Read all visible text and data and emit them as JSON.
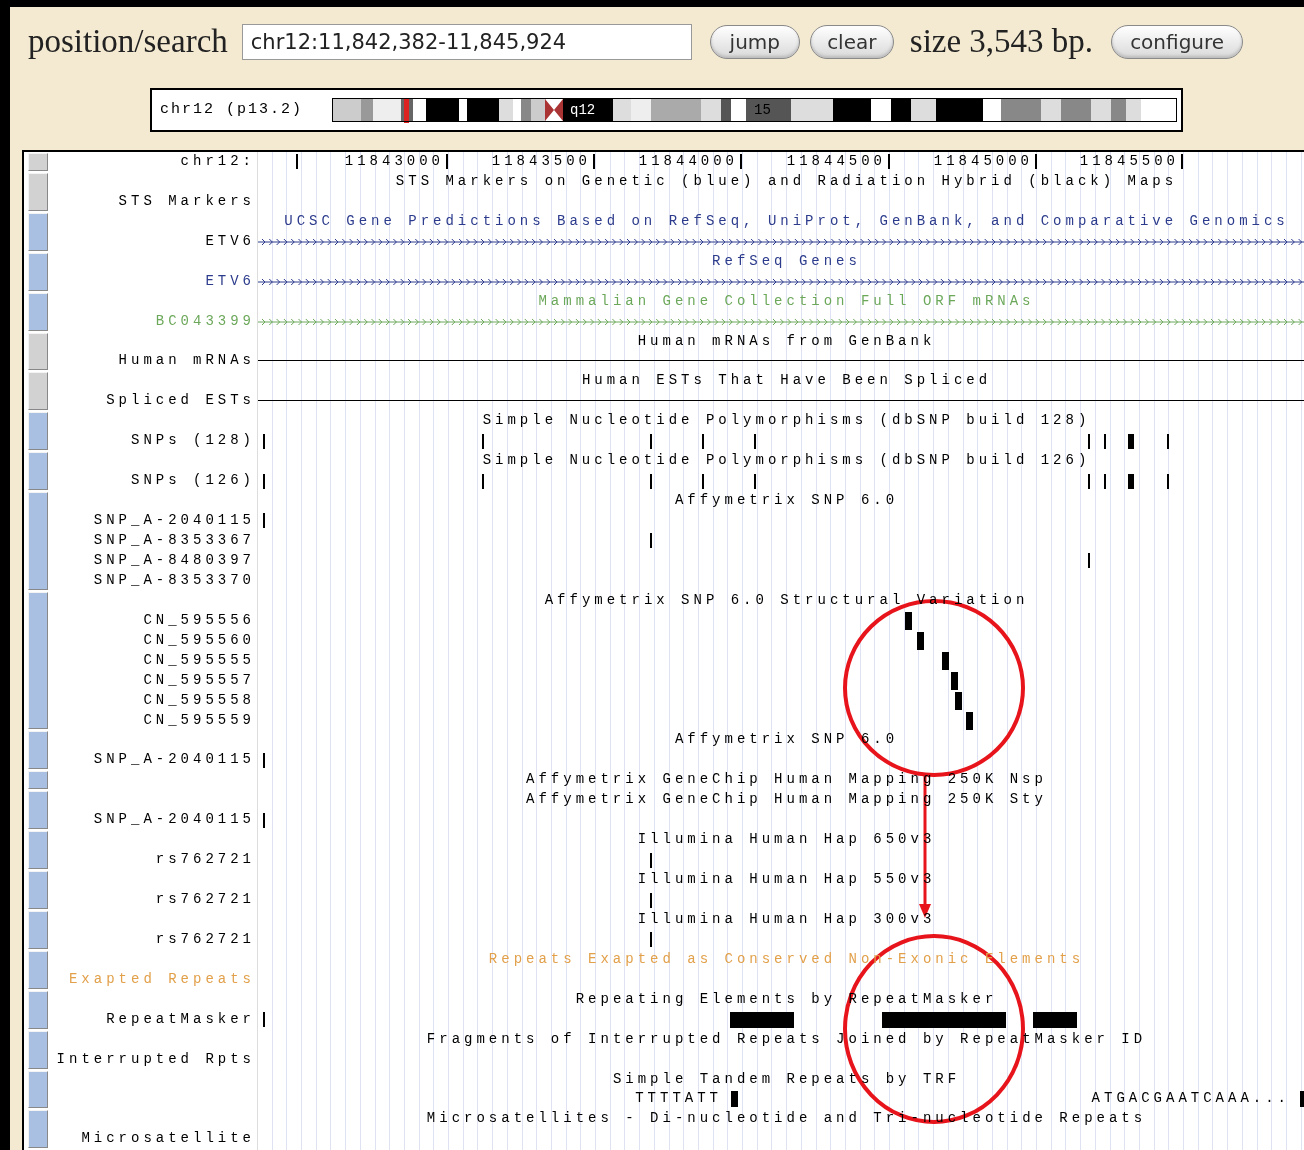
{
  "search": {
    "label": "position/search",
    "value": "chr12:11,842,382-11,845,924",
    "buttons": [
      "jump",
      "clear"
    ],
    "size": "size 3,543 bp.",
    "configure": "configure"
  },
  "ideogram": {
    "label": "chr12 (p13.2)",
    "bands": [
      "q12",
      "15"
    ]
  },
  "ruler": {
    "label": "chr12:",
    "button": {
      "color": "#d2d2d2"
    },
    "ticks": [
      "11843000",
      "11843500",
      "11844000",
      "11844500",
      "11845000",
      "11845500"
    ]
  },
  "tracks": [
    {
      "title": "STS Markers on Genetic (blue) and Radiation Hybrid (black) Maps",
      "color": "#000000",
      "button": {
        "color": "#d2d2d2"
      },
      "rows": [
        {
          "label": "STS Markers",
          "color": "#000000",
          "kind": "empty"
        }
      ]
    },
    {
      "title": "UCSC Gene Predictions Based on RefSeq, UniProt, GenBank, and Comparative Genomics",
      "color": "#2c3b8c",
      "button": {
        "color": "#a9c0e3"
      },
      "rows": [
        {
          "label": "ETV6",
          "color": "#000000",
          "kind": "gene"
        }
      ]
    },
    {
      "title": "RefSeq Genes",
      "color": "#2c3b8c",
      "button": {
        "color": "#a9c0e3"
      },
      "rows": [
        {
          "label": "ETV6",
          "color": "#2c3b8c",
          "kind": "gene"
        }
      ]
    },
    {
      "title": "Mammalian Gene Collection Full ORF mRNAs",
      "color": "#6ca85a",
      "button": {
        "color": "#a9c0e3"
      },
      "rows": [
        {
          "label": "BC043399",
          "color": "#6ca85a",
          "kind": "gene"
        }
      ]
    },
    {
      "title": "Human mRNAs from GenBank",
      "color": "#000000",
      "button": {
        "color": "#d2d2d2"
      },
      "rows": [
        {
          "label": "Human mRNAs",
          "color": "#000000",
          "kind": "line"
        }
      ]
    },
    {
      "title": "Human ESTs That Have Been Spliced",
      "color": "#000000",
      "button": {
        "color": "#d2d2d2"
      },
      "rows": [
        {
          "label": "Spliced ESTs",
          "color": "#000000",
          "kind": "line"
        }
      ]
    },
    {
      "title": "Simple Nucleotide Polymorphisms (dbSNP build 128)",
      "color": "#000000",
      "button": {
        "color": "#a9c0e3"
      },
      "rows": [
        {
          "label": "SNPs (128)",
          "color": "#000000",
          "kind": "features"
        }
      ]
    },
    {
      "title": "Simple Nucleotide Polymorphisms (dbSNP build 126)",
      "color": "#000000",
      "button": {
        "color": "#a9c0e3"
      },
      "rows": [
        {
          "label": "SNPs (126)",
          "color": "#000000",
          "kind": "features"
        }
      ]
    },
    {
      "title": "Affymetrix SNP 6.0",
      "color": "#000000",
      "button": {
        "color": "#a9c0e3"
      },
      "rows": [
        {
          "label": "SNP_A-2040115",
          "color": "#000000",
          "kind": "features"
        },
        {
          "label": "SNP_A-8353367",
          "color": "#000000",
          "kind": "features"
        },
        {
          "label": "SNP_A-8480397",
          "color": "#000000",
          "kind": "features"
        },
        {
          "label": "SNP_A-8353370",
          "color": "#000000",
          "kind": "empty"
        }
      ]
    },
    {
      "title": "Affymetrix SNP 6.0 Structural Variation",
      "color": "#000000",
      "button": {
        "color": "#a9c0e3"
      },
      "rows": [
        {
          "label": "CN_595556",
          "color": "#000000",
          "kind": "features"
        },
        {
          "label": "CN_595560",
          "color": "#000000",
          "kind": "features"
        },
        {
          "label": "CN_595555",
          "color": "#000000",
          "kind": "features"
        },
        {
          "label": "CN_595557",
          "color": "#000000",
          "kind": "features"
        },
        {
          "label": "CN_595558",
          "color": "#000000",
          "kind": "features"
        },
        {
          "label": "CN_595559",
          "color": "#000000",
          "kind": "features"
        }
      ]
    },
    {
      "title": "Affymetrix SNP 6.0",
      "color": "#000000",
      "button": {
        "color": "#a9c0e3"
      },
      "rows": [
        {
          "label": "SNP_A-2040115",
          "color": "#000000",
          "kind": "features"
        }
      ]
    },
    {
      "title": "Affymetrix GeneChip Human Mapping 250K Nsp",
      "color": "#000000",
      "button": {
        "color": "#a9c0e3"
      }
    },
    {
      "title": "Affymetrix GeneChip Human Mapping 250K Sty",
      "color": "#000000",
      "button": {
        "color": "#a9c0e3"
      },
      "rows": [
        {
          "label": "SNP_A-2040115",
          "color": "#000000",
          "kind": "features"
        }
      ]
    },
    {
      "title": "Illumina Human Hap 650v3",
      "color": "#000000",
      "button": {
        "color": "#a9c0e3"
      },
      "rows": [
        {
          "label": "rs762721",
          "color": "#000000",
          "kind": "features"
        }
      ]
    },
    {
      "title": "Illumina Human Hap 550v3",
      "color": "#000000",
      "button": {
        "color": "#a9c0e3"
      },
      "rows": [
        {
          "label": "rs762721",
          "color": "#000000",
          "kind": "features"
        }
      ]
    },
    {
      "title": "Illumina Human Hap 300v3",
      "color": "#000000",
      "button": {
        "color": "#a9c0e3"
      },
      "rows": [
        {
          "label": "rs762721",
          "color": "#000000",
          "kind": "features"
        }
      ]
    },
    {
      "title": "Repeats Exapted as Conserved Non-Exonic Elements",
      "color": "#e2a04a",
      "button": {
        "color": "#a9c0e3"
      },
      "rows": [
        {
          "label": "Exapted Repeats",
          "color": "#e2a04a",
          "kind": "empty"
        }
      ]
    },
    {
      "title": "Repeating Elements by RepeatMasker",
      "color": "#000000",
      "button": {
        "color": "#a9c0e3"
      },
      "rows": [
        {
          "label": "RepeatMasker",
          "color": "#000000",
          "kind": "features"
        }
      ]
    },
    {
      "title": "Fragments of Interrupted Repeats Joined by RepeatMasker ID",
      "color": "#000000",
      "button": {
        "color": "#a9c0e3"
      },
      "rows": [
        {
          "label": "Interrupted Rpts",
          "color": "#000000",
          "kind": "empty"
        }
      ]
    },
    {
      "title": "Simple Tandem Repeats by TRF",
      "color": "#000000",
      "button": {
        "color": "#a9c0e3"
      },
      "rows": [
        {
          "color": "#000000",
          "kind": "features",
          "feature_labels": [
            "TTTTATT",
            "ATGACGAATCAAA..."
          ]
        }
      ]
    },
    {
      "title": "Microsatellites - Di-nucleotide and Tri-nucleotide Repeats",
      "color": "#000000",
      "button": {
        "color": "#a9c0e3"
      },
      "rows": [
        {
          "label": "Microsatellite",
          "color": "#000000",
          "kind": "empty"
        }
      ]
    }
  ]
}
